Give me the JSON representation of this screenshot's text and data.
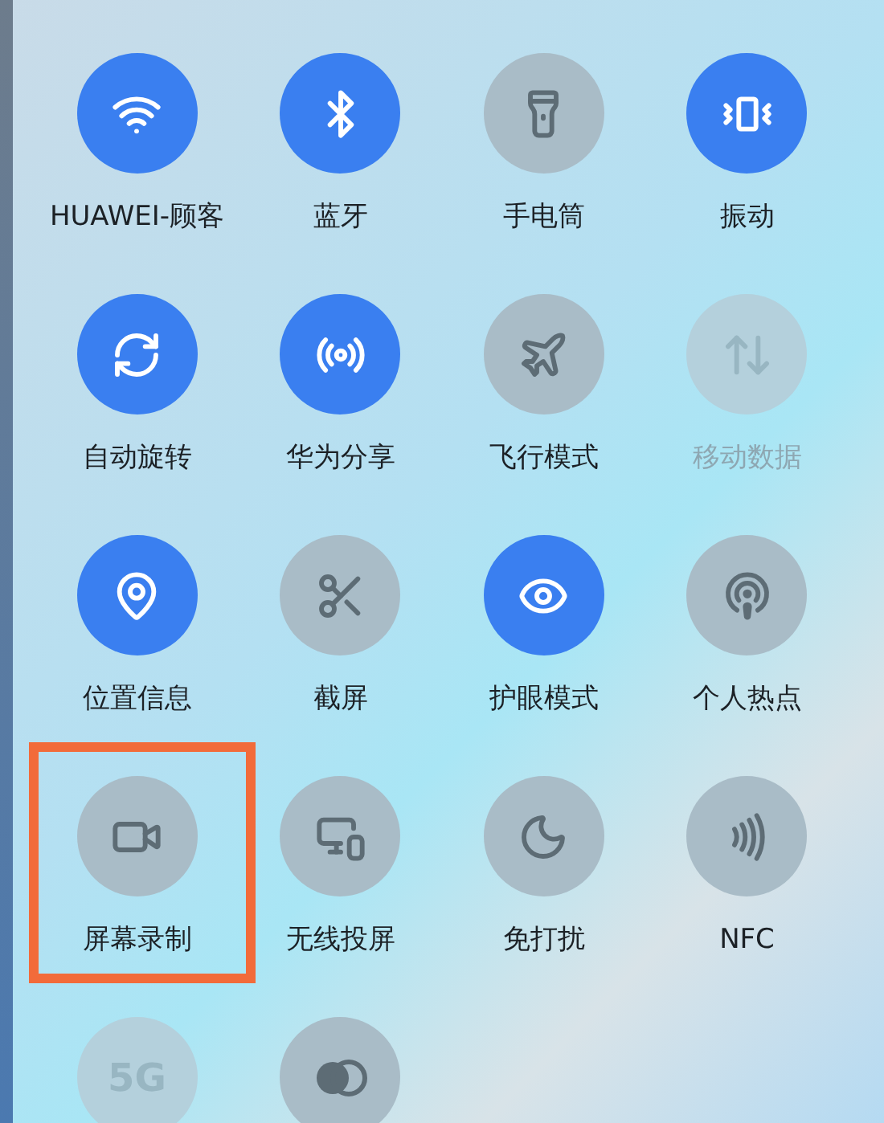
{
  "tiles": [
    {
      "label": "HUAWEI-顾客",
      "on": true,
      "disabled": false,
      "highlighted": false
    },
    {
      "label": "蓝牙",
      "on": true,
      "disabled": false,
      "highlighted": false
    },
    {
      "label": "手电筒",
      "on": false,
      "disabled": false,
      "highlighted": false
    },
    {
      "label": "振动",
      "on": true,
      "disabled": false,
      "highlighted": false
    },
    {
      "label": "自动旋转",
      "on": true,
      "disabled": false,
      "highlighted": false
    },
    {
      "label": "华为分享",
      "on": true,
      "disabled": false,
      "highlighted": false
    },
    {
      "label": "飞行模式",
      "on": false,
      "disabled": false,
      "highlighted": false
    },
    {
      "label": "移动数据",
      "on": false,
      "disabled": true,
      "highlighted": false
    },
    {
      "label": "位置信息",
      "on": true,
      "disabled": false,
      "highlighted": false
    },
    {
      "label": "截屏",
      "on": false,
      "disabled": false,
      "highlighted": false
    },
    {
      "label": "护眼模式",
      "on": true,
      "disabled": false,
      "highlighted": false
    },
    {
      "label": "个人热点",
      "on": false,
      "disabled": false,
      "highlighted": false
    },
    {
      "label": "屏幕录制",
      "on": false,
      "disabled": false,
      "highlighted": true
    },
    {
      "label": "无线投屏",
      "on": false,
      "disabled": false,
      "highlighted": false
    },
    {
      "label": "免打扰",
      "on": false,
      "disabled": false,
      "highlighted": false
    },
    {
      "label": "NFC",
      "on": false,
      "disabled": false,
      "highlighted": false
    },
    {
      "icon_text": "5G",
      "on": false,
      "disabled": true,
      "highlighted": false
    },
    {
      "on": false,
      "disabled": false,
      "highlighted": false
    }
  ]
}
